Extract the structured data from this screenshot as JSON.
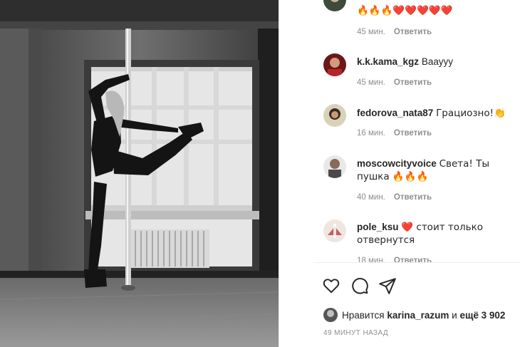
{
  "comments": [
    {
      "user": "",
      "text": "🔥🔥🔥❤️❤️❤️❤️❤️",
      "time": "45 мин.",
      "reply": "Ответить"
    },
    {
      "user": "k.k.kama_kgz",
      "text": "Вааууу",
      "time": "45 мин.",
      "reply": "Ответить"
    },
    {
      "user": "fedorova_nata87",
      "text": "Грациозно!👏",
      "time": "16 мин.",
      "reply": "Ответить"
    },
    {
      "user": "moscowcityvoice",
      "text": "Света! Ты пушка 🔥🔥🔥",
      "time": "40 мин.",
      "reply": "Ответить"
    },
    {
      "user": "pole_ksu",
      "text": "❤️ стоит только отвернутся",
      "time": "18 мин.",
      "reply": "Ответить"
    }
  ],
  "actions": {
    "like_icon": "heart-outline-icon",
    "comment_icon": "speech-bubble-icon",
    "share_icon": "paper-plane-icon"
  },
  "likes": {
    "prefix": "Нравится",
    "user": "karina_razum",
    "conj": "и",
    "rest": "ещё 3 902"
  },
  "posted": "49 МИНУТ НАЗАД"
}
